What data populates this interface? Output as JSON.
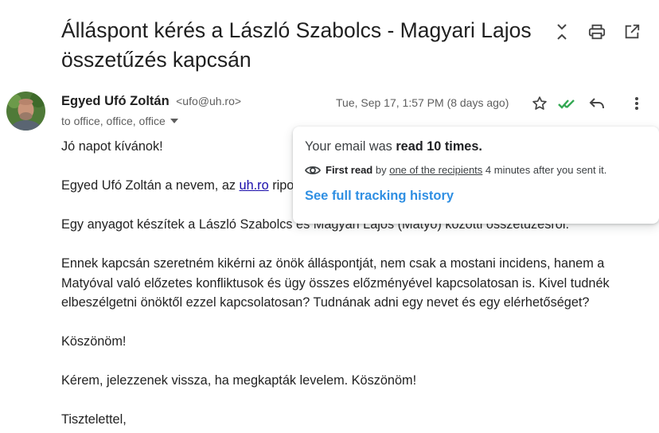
{
  "subject": "Álláspont kérés a László Szabolcs - Magyari Lajos összetűzés kapcsán",
  "toolbar": {
    "icons": [
      "collapse-icon",
      "print-icon",
      "open-in-new-window-icon"
    ]
  },
  "sender": {
    "name": "Egyed Ufó Zoltán",
    "email": "<ufo@uh.ro>",
    "to_line": "to office, office, office"
  },
  "message": {
    "date": "Tue, Sep 17, 1:57 PM (8 days ago)",
    "icons": [
      "star-icon",
      "double-check-icon",
      "reply-icon",
      "more-vert-icon"
    ],
    "colors": {
      "check": "#34a853",
      "link": "#1a0dab"
    }
  },
  "body": {
    "greeting": "Jó napot kívánok!",
    "p2_before": "Egyed Ufó Zoltán a nevem, az ",
    "p2_link": "uh.ro",
    "p2_after": " ripo",
    "p3": "Egy anyagot készítek a László Szabolcs és Magyari Lajos (Matyó) közötti összetűzésről.",
    "p4": "Ennek kapcsán szeretném kikérni az önök álláspontját, nem csak a mostani incidens, hanem a Matyóval való előzetes konfliktusok és ügy összes előzményével kapcsolatosan is. Kivel tudnék elbeszélgetni önöktől ezzel kapcsolatosan? Tudnának adni egy nevet és egy elérhetőséget?",
    "p5": "Köszönöm!",
    "p6": "Kérem, jelezzenek vissza, ha megkapták levelem. Köszönöm!",
    "p7": "Tisztelettel,"
  },
  "tracking_popup": {
    "title_prefix": "Your email was ",
    "title_bold": "read 10 times.",
    "first_read_label": "First read",
    "by": " by ",
    "recipients_link": "one of the recipients",
    "after": " 4 minutes after you sent it.",
    "history_link": "See full tracking history",
    "accent_color": "#2f8fe3"
  }
}
